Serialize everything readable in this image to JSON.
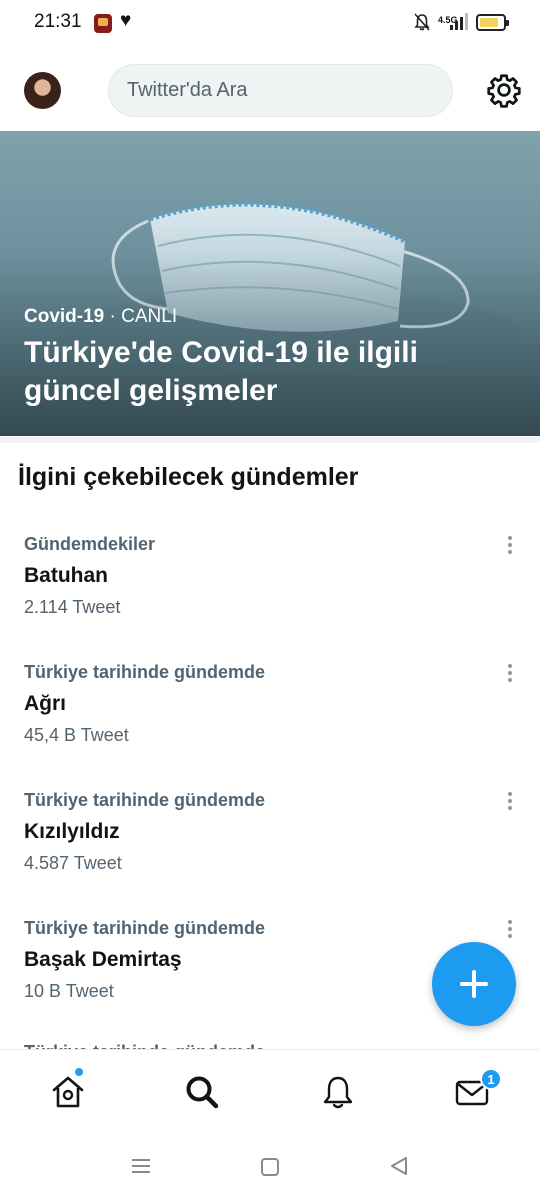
{
  "status_bar": {
    "time": "21:31",
    "network": "4.5G"
  },
  "header": {
    "search_placeholder": "Twitter'da Ara"
  },
  "hero": {
    "topic": "Covid-19",
    "separator": " · ",
    "live_label": "CANLI",
    "title": "Türkiye'de Covid-19 ile ilgili güncel gelişmeler"
  },
  "trends_section": {
    "title": "İlgini çekebilecek gündemler",
    "items": [
      {
        "context": "Gündemdekiler",
        "name": "Batuhan",
        "count": "2.114 Tweet"
      },
      {
        "context": "Türkiye tarihinde gündemde",
        "name": "Ağrı",
        "count": "45,4 B Tweet"
      },
      {
        "context": "Türkiye tarihinde gündemde",
        "name": "Kızılyıldız",
        "count": "4.587 Tweet"
      },
      {
        "context": "Türkiye tarihinde gündemde",
        "name": "Başak Demirtaş",
        "count": "10 B Tweet"
      }
    ],
    "partial_context": "Türkiye tarihinde gündemde"
  },
  "bottom_nav": {
    "messages_badge": "1"
  },
  "colors": {
    "accent": "#1d9bf0",
    "secondary_text": "#536471",
    "primary_text": "#0f1419"
  }
}
